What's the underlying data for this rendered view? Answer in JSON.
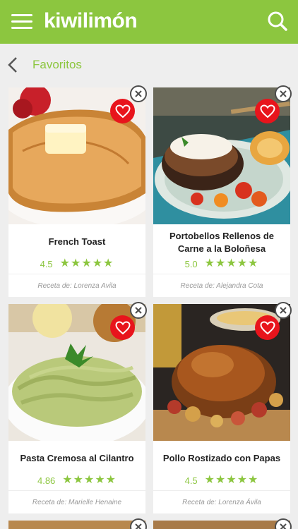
{
  "app": {
    "logo": "kiwilimón"
  },
  "header": {
    "menu_icon": "hamburger-menu-icon",
    "search_icon": "search-icon"
  },
  "subheader": {
    "title": "Favoritos",
    "back_icon": "chevron-left-icon"
  },
  "colors": {
    "brand": "#8cc63f",
    "favorite": "#e8141c",
    "text": "#222222",
    "muted": "#999999"
  },
  "recipes": [
    {
      "title": "French Toast",
      "rating": "4.5",
      "stars": "★★★★★",
      "author": "Receta de: Lorenza Avila"
    },
    {
      "title": "Portobellos Rellenos de Carne a la Boloñesa",
      "rating": "5.0",
      "stars": "★★★★★",
      "author": "Receta de: Alejandra Cota"
    },
    {
      "title": "Pasta Cremosa al Cilantro",
      "rating": "4.86",
      "stars": "★★★★★",
      "author": "Receta de: Marielle  Henaine"
    },
    {
      "title": "Pollo Rostizado con Papas",
      "rating": "4.5",
      "stars": "★★★★★",
      "author": "Receta de: Lorenza  Ávila"
    }
  ]
}
